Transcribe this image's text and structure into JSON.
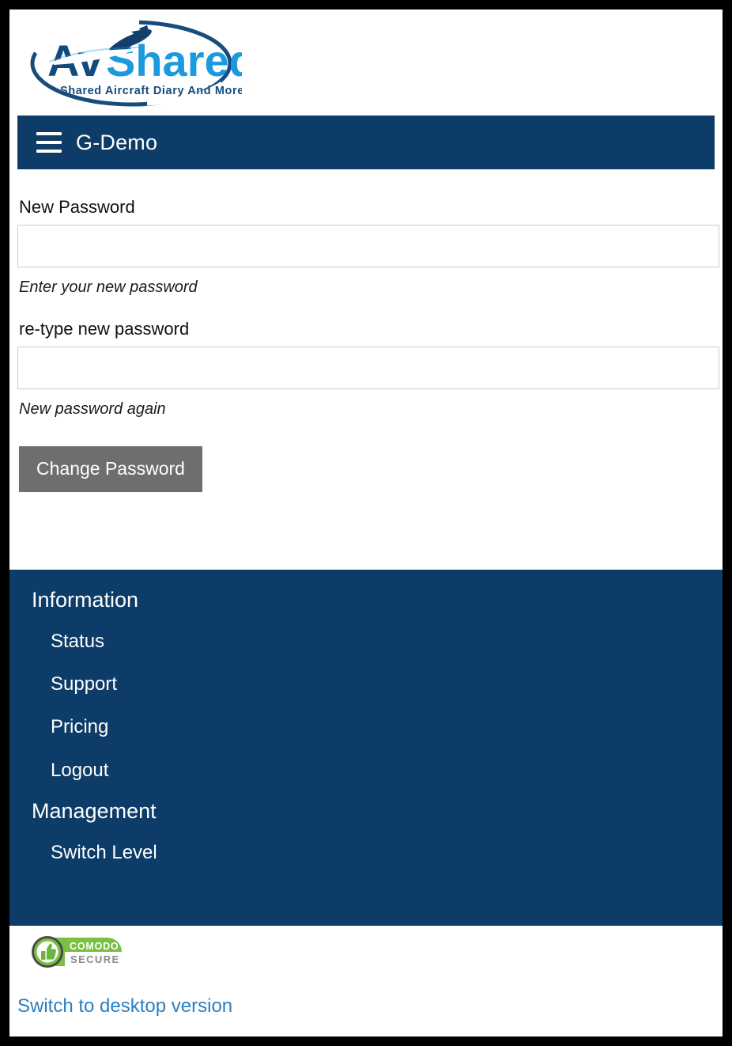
{
  "brand": {
    "name_part1": "Av",
    "name_part2": "Shared",
    "tagline": "Shared Aircraft Diary And More",
    "color_dark": "#124a7d",
    "color_light": "#1b9ae0"
  },
  "navbar": {
    "menu_icon": "hamburger-menu-icon",
    "title": "G-Demo",
    "background": "#0c3c67"
  },
  "form": {
    "new_password": {
      "label": "New Password",
      "value": "",
      "placeholder": "",
      "help": "Enter your new password"
    },
    "confirm_password": {
      "label": "re-type new password",
      "value": "",
      "placeholder": "",
      "help": "New password again"
    },
    "submit_label": "Change Password",
    "submit_color": "#6e6e6e"
  },
  "nav": {
    "sections": [
      {
        "heading": "Information",
        "items": [
          {
            "label": "Status"
          },
          {
            "label": "Support"
          },
          {
            "label": "Pricing"
          },
          {
            "label": "Logout"
          }
        ]
      },
      {
        "heading": "Management",
        "items": [
          {
            "label": "Switch Level"
          }
        ]
      }
    ]
  },
  "footer": {
    "badge": {
      "icon": "thumbs-up-icon",
      "line1": "COMODO",
      "line2": "SECURE",
      "green": "#7ac043",
      "gray": "#8a8a8a"
    },
    "desktop_link": "Switch to desktop version",
    "link_color": "#2a7fc1"
  }
}
